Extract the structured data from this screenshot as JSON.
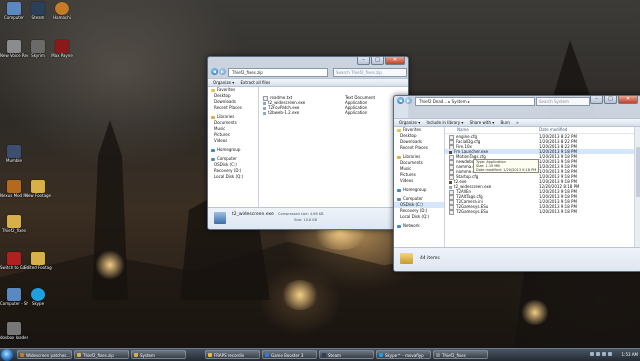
{
  "desktop": {
    "icons": [
      {
        "label": "Computer",
        "color": "#5a88c0"
      },
      {
        "label": "Steam",
        "color": "#2a3f5a"
      },
      {
        "label": "Hamachi",
        "color": "#c47a26"
      },
      {
        "label": "New Voice Recorder",
        "color": "#8c8c8c"
      },
      {
        "label": "Skyrim",
        "color": "#6a6a6a"
      },
      {
        "label": "Max Payne",
        "color": "#8a1a1a"
      },
      {
        "label": "Mumble",
        "color": "#3d4f70"
      },
      {
        "label": "Nexus Mod Manager",
        "color": "#b36a1f"
      },
      {
        "label": "New Footage",
        "color": "#d8b04a"
      },
      {
        "label": "Thief2_fixes",
        "color": "#d8b04a"
      },
      {
        "label": "Switch to Gamma",
        "color": "#b02020"
      },
      {
        "label": "Edited Footage",
        "color": "#d8b04a"
      },
      {
        "label": "Computer - Shortcut",
        "color": "#5a88c0"
      },
      {
        "label": "Skype",
        "color": "#1e9fe0"
      },
      {
        "label": "dosbox loader - Shortcut",
        "color": "#777777"
      }
    ]
  },
  "window1": {
    "address": "Thief2_fixes.zip",
    "search_placeholder": "Search Thief2_fixes.zip",
    "toolbar": {
      "organize": "Organize ▾",
      "extract": "Extract all files"
    },
    "nav": {
      "favorites": "Favorites",
      "favorites_items": [
        "Desktop",
        "Downloads",
        "Recent Places"
      ],
      "libraries": "Libraries",
      "libraries_items": [
        "Documents",
        "Music",
        "Pictures",
        "Videos"
      ],
      "homegroup": "Homegroup",
      "computer": "Computer",
      "computer_items": [
        "OSDisk (C:)",
        "Recovery (D:)",
        "Local Disk (Q:)"
      ]
    },
    "files": [
      {
        "name": "readme.txt",
        "type": "Text Document"
      },
      {
        "name": "t2_widescreen.exe",
        "type": "Application"
      },
      {
        "name": "T2FovPatch.exe",
        "type": "Application"
      },
      {
        "name": "t2bweb-1.2.exe",
        "type": "Application"
      }
    ],
    "details": {
      "name": "t2_widescreen.exe",
      "compressed": "Compressed size: 4.86 KB",
      "size": "Size: 10.8 KB"
    }
  },
  "window2": {
    "address": "Thief2 Dead... ▸ System ▸",
    "search_placeholder": "Search System",
    "toolbar": {
      "organize": "Organize ▾",
      "include": "Include in library ▾",
      "share": "Share with ▾",
      "burn": "Burn",
      "more": "»"
    },
    "columns": {
      "name": "Name",
      "date": "Date modified"
    },
    "nav": {
      "favorites": "Favorites",
      "favorites_items": [
        "Desktop",
        "Downloads",
        "Recent Places"
      ],
      "libraries": "Libraries",
      "libraries_items": [
        "Documents",
        "Music",
        "Pictures",
        "Videos"
      ],
      "homegroup": "Homegroup",
      "computer": "Computer",
      "computer_items": [
        "OSDisk (C:)",
        "Recovery (D:)",
        "Local Disk (Q:)"
      ],
      "network": "Network"
    },
    "files": [
      {
        "name": "engine.cfg",
        "date": "1/20/2013 8:22 PM"
      },
      {
        "name": "FacialDg.cfg",
        "date": "1/20/2013 8:22 PM"
      },
      {
        "name": "Fire.10x",
        "date": "1/20/2013 8:22 PM"
      },
      {
        "name": "Fm Launcher.exe",
        "date": "1/20/2013 9:18 PM"
      },
      {
        "name": "MotionTags.cfg",
        "date": "1/20/2013 9:18 PM"
      },
      {
        "name": "newdebugtwo.cfg",
        "date": "1/20/2013 9:18 PM"
      },
      {
        "name": "namma.dat",
        "date": "1/20/2013 9:18 PM"
      },
      {
        "name": "namme.dat",
        "date": "1/20/2013 9:18 PM"
      },
      {
        "name": "Startup.cfg",
        "date": "1/20/2013 9:18 PM"
      },
      {
        "name": "t2.exe",
        "date": "1/20/2013 9:18 PM"
      },
      {
        "name": "t2_widescreen.exe",
        "date": "12/20/2012 8:18 PM"
      },
      {
        "name": "T2AllEn",
        "date": "1/20/2013 9:18 PM"
      },
      {
        "name": "T2AltTags.cfg",
        "date": "1/20/2013 9:18 PM"
      },
      {
        "name": "T2Camera.ini",
        "date": "1/20/2013 9:18 PM"
      },
      {
        "name": "T2Gamesys.ESu",
        "date": "1/20/2013 9:18 PM"
      },
      {
        "name": "T2Gamesys.ESu",
        "date": "1/20/2013 9:18 PM"
      }
    ],
    "selected_index": 3,
    "tooltip_lines": [
      "Type: Application",
      "Size: 1.19 MB",
      "Date modified: 1/20/2013 9:18 PM"
    ],
    "details_count": "44 items"
  },
  "taskbar": {
    "items": [
      {
        "label": "Widescreen patches...",
        "color": "#c47a26"
      },
      {
        "label": "Thief2_fixes.zip",
        "color": "#d8b04a"
      },
      {
        "label": "System",
        "color": "#d8b04a"
      },
      {
        "label": "FRAPS recordin",
        "color": "#e0c030"
      },
      {
        "label": "Game Booster 3",
        "color": "#3a7ad0"
      },
      {
        "label": "Steam",
        "color": "#2a3f5a"
      },
      {
        "label": "Skype™ - movaflyp",
        "color": "#1e9fe0"
      },
      {
        "label": "Thief2_fixes",
        "color": "#888888"
      }
    ],
    "clock": "1:53 AM"
  }
}
